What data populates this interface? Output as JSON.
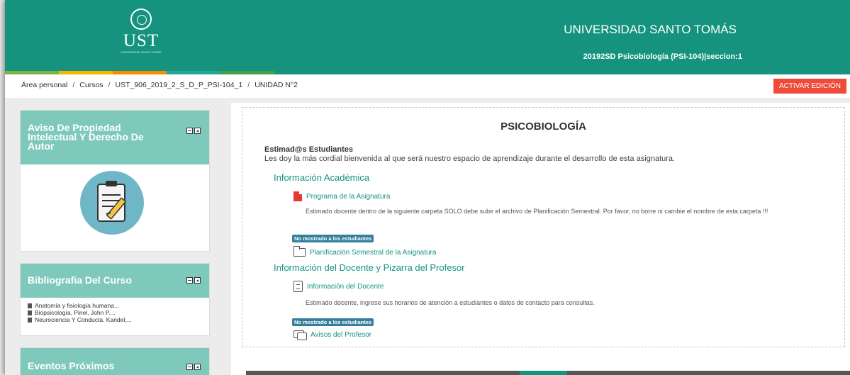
{
  "header": {
    "logo_text": "UST",
    "logo_subtitle": "UNIVERSIDAD SANTO TOMÁS",
    "university": "UNIVERSIDAD SANTO TOMÁS",
    "course": "20192SD Psicobiología (PSI-104)|seccion:1",
    "accent": "#15937f",
    "strip_colors": [
      "#7cb342",
      "#ffb300",
      "#fb8c00",
      "#26a69a",
      "#43a047"
    ]
  },
  "breadcrumb": {
    "items": [
      "Área personal",
      "Cursos",
      "UST_906_2019_2_S_D_P_PSI-104_1",
      "UNIDAD N°2"
    ],
    "separator": "/"
  },
  "edit_button": "ACTIVAR EDICIÓN",
  "blocks": {
    "notice": {
      "title": "Aviso De Propiedad Intelectual Y Derecho De Autor"
    },
    "bibliography": {
      "title": "Bibliografia Del Curso",
      "items": [
        "Anatomía y fisiología humana...",
        "Biopsicología. Pinel, John P....",
        "Neurociencia Y Conducta. Kandel,..."
      ]
    },
    "events": {
      "title": "Eventos Próximos"
    }
  },
  "main": {
    "title": "PSICOBIOLOGÍA",
    "greeting": "Estimad@s Estudiantes",
    "greeting_body": "Les doy la más cordial bienvenida al que será nuestro espacio de aprendizaje durante el desarrollo de esta asignatura.",
    "section1": {
      "title": "Información Académica",
      "activity1": "Programa de la Asignatura",
      "activity1_desc": "Estimado docente dentro de la siguiente carpeta SOLO debe subir el archivo de Planificación Semestral. Por favor, no borre ni cambie el nombre de esta carpeta !!!",
      "badge": "No mostrado a los estudiantes",
      "activity2": "Planificación Semestral de la Asignatura"
    },
    "section2": {
      "title": "Información del Docente y Pizarra del Profesor",
      "activity1": "Información del Docente",
      "activity1_desc": "Estimado docente, ingrese sus horarios de atención a estudiantes o datos de contacto para consultas.",
      "badge": "No mostrado a los estudiantes",
      "activity2": "Avisos del Profesor"
    }
  }
}
